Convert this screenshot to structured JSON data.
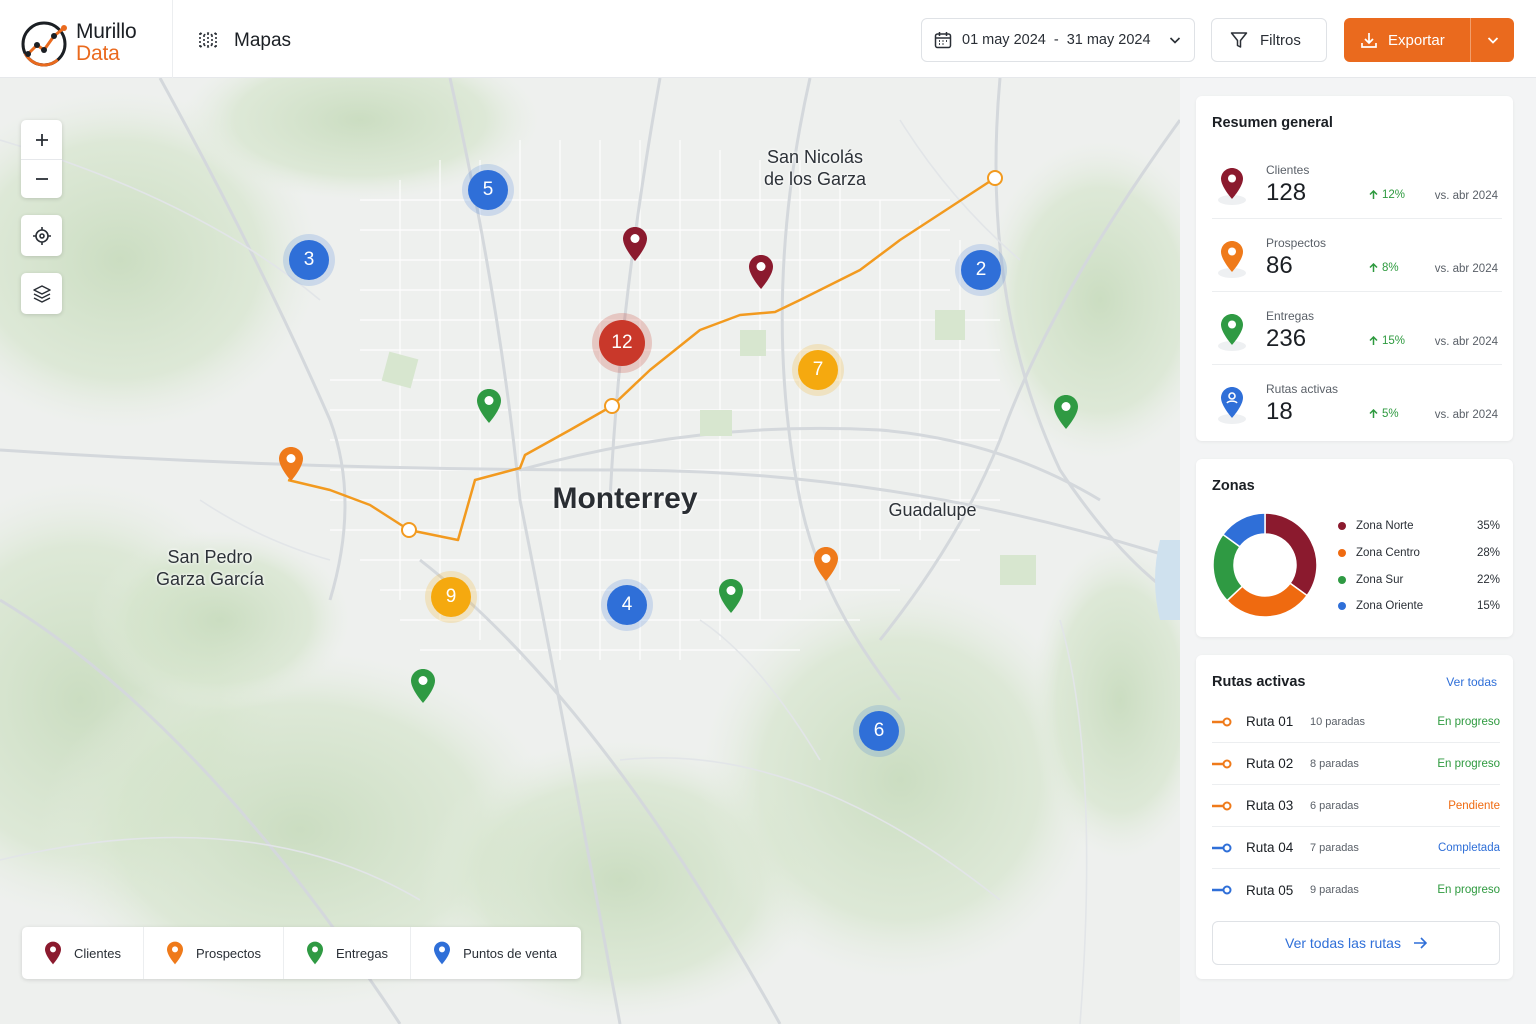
{
  "brand": {
    "name_line1": "Murillo",
    "name_line2": "Data"
  },
  "header": {
    "page_title": "Mapas",
    "date_start": "01 may 2024",
    "date_sep": "-",
    "date_end": "31 may 2024",
    "filters_label": "Filtros",
    "export_label": "Exportar"
  },
  "colors": {
    "accent": "#ea6a1e",
    "clientes": "#8b1a2e",
    "prospectos": "#ef7a1a",
    "entregas": "#2f9a43",
    "puntos_venta": "#2f6fd8",
    "route": "#f29a1f"
  },
  "map": {
    "controls": {
      "zoom_in": "+",
      "zoom_out": "−",
      "locate_icon": "crosshair-icon",
      "layers_icon": "layers-icon"
    },
    "places": {
      "san_nicolas_1": "San Nicolás",
      "san_nicolas_2": "de los Garza",
      "monterrey": "Monterrey",
      "guadalupe": "Guadalupe",
      "san_pedro_1": "San Pedro",
      "san_pedro_2": "Garza García"
    },
    "clusters": [
      {
        "count": "5",
        "color": "#2f6fd8"
      },
      {
        "count": "3",
        "color": "#2f6fd8"
      },
      {
        "count": "12",
        "color": "#c9382a"
      },
      {
        "count": "2",
        "color": "#2f6fd8"
      },
      {
        "count": "7",
        "color": "#f5a90f"
      },
      {
        "count": "9",
        "color": "#f5a90f"
      },
      {
        "count": "4",
        "color": "#2f6fd8"
      },
      {
        "count": "6",
        "color": "#2f6fd8"
      }
    ],
    "legend": [
      {
        "label": "Clientes",
        "color": "#8b1a2e"
      },
      {
        "label": "Prospectos",
        "color": "#ef7a1a"
      },
      {
        "label": "Entregas",
        "color": "#2f9a43"
      },
      {
        "label": "Puntos de venta",
        "color": "#2f6fd8"
      }
    ]
  },
  "summary": {
    "title": "Resumen general",
    "stats": [
      {
        "label": "Clientes",
        "value": "128",
        "change": "12%",
        "compare": "vs. abr 2024",
        "color": "#8b1a2e"
      },
      {
        "label": "Prospectos",
        "value": "86",
        "change": "8%",
        "compare": "vs. abr 2024",
        "color": "#ef7a1a"
      },
      {
        "label": "Entregas",
        "value": "236",
        "change": "15%",
        "compare": "vs. abr 2024",
        "color": "#2f9a43"
      },
      {
        "label": "Rutas activas",
        "value": "18",
        "change": "5%",
        "compare": "vs. abr 2024",
        "color": "#2f6fd8"
      }
    ]
  },
  "zones": {
    "title": "Zonas",
    "items": [
      {
        "label": "Zona Norte",
        "pct": "35%",
        "value": 35,
        "color": "#8b1a2e"
      },
      {
        "label": "Zona Centro",
        "pct": "28%",
        "value": 28,
        "color": "#ef6a10"
      },
      {
        "label": "Zona Sur",
        "pct": "22%",
        "value": 22,
        "color": "#2f9a43"
      },
      {
        "label": "Zona Oriente",
        "pct": "15%",
        "value": 15,
        "color": "#2f6fd8"
      }
    ]
  },
  "routes": {
    "title": "Rutas activas",
    "see_all": "Ver todas",
    "items": [
      {
        "name": "Ruta 01",
        "stops": "10 paradas",
        "status": "En progreso",
        "status_color": "#2e9a3f",
        "icon_color": "#ef7a1a"
      },
      {
        "name": "Ruta 02",
        "stops": "8 paradas",
        "status": "En progreso",
        "status_color": "#2e9a3f",
        "icon_color": "#ef7a1a"
      },
      {
        "name": "Ruta 03",
        "stops": "6 paradas",
        "status": "Pendiente",
        "status_color": "#ef6a10",
        "icon_color": "#ef7a1a"
      },
      {
        "name": "Ruta 04",
        "stops": "7 paradas",
        "status": "Completada",
        "status_color": "#2f6fd8",
        "icon_color": "#2f6fd8"
      },
      {
        "name": "Ruta 05",
        "stops": "9 paradas",
        "status": "En progreso",
        "status_color": "#2e9a3f",
        "icon_color": "#2f6fd8"
      }
    ],
    "see_all_routes": "Ver todas las rutas"
  }
}
